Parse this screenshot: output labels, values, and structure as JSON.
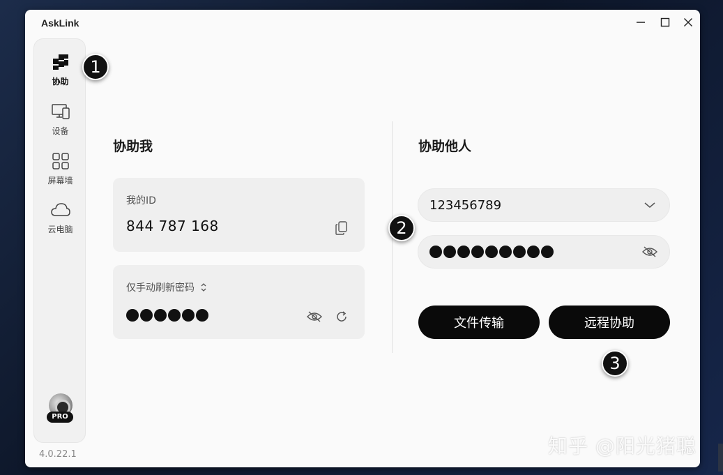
{
  "app": {
    "title": "AskLink",
    "version": "4.0.22.1"
  },
  "window_controls": {
    "minimize_icon": "minimize-icon",
    "maximize_icon": "maximize-icon",
    "close_icon": "close-icon"
  },
  "sidebar": {
    "items": [
      {
        "label": "协助",
        "icon": "assist-icon",
        "active": true
      },
      {
        "label": "设备",
        "icon": "devices-icon",
        "active": false
      },
      {
        "label": "屏幕墙",
        "icon": "grid-icon",
        "active": false
      },
      {
        "label": "云电脑",
        "icon": "cloud-icon",
        "active": false
      }
    ],
    "badge": "PRO"
  },
  "help_me": {
    "title": "协助我",
    "id_label": "我的ID",
    "id_value": "844 787 168",
    "password_mode": "仅手动刷新密码",
    "password_length": 6
  },
  "help_others": {
    "title": "协助他人",
    "device_id": "123456789",
    "password_length": 9,
    "file_transfer_label": "文件传输",
    "remote_assist_label": "远程协助"
  },
  "annotations": {
    "step1": "1",
    "step2": "2",
    "step3": "3"
  },
  "watermark": "知乎 @阳光猪聪",
  "colors": {
    "accent": "#0a0a0a",
    "background": "#fafafa",
    "card": "#efefef"
  }
}
